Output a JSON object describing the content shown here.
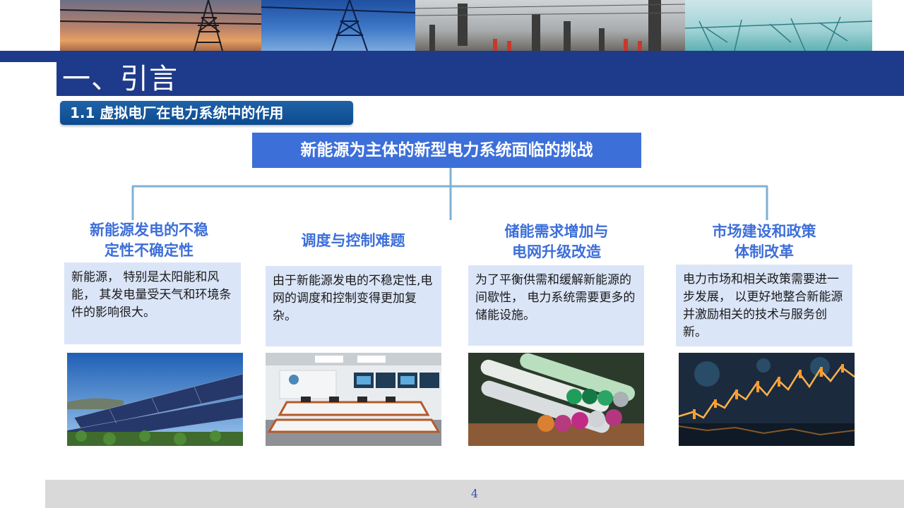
{
  "header": {
    "title": "一、引言",
    "subtitle": "1.1 虚拟电厂在电力系统中的作用"
  },
  "center_box": {
    "label": "新能源为主体的新型电力系统面临的挑战"
  },
  "columns": [
    {
      "heading": [
        "新能源发电的不稳",
        "定性不确定性"
      ],
      "body": "新能源， 特别是太阳能和风能， 其发电量受天气和环境条件的影响很大。",
      "image": "solar-panels-image"
    },
    {
      "heading": [
        "调度与控制难题"
      ],
      "body": "由于新能源发电的不稳定性,电网的调度和控制变得更加复杂。",
      "image": "control-room-image"
    },
    {
      "heading": [
        "储能需求增加与",
        "电网升级改造"
      ],
      "body": "为了平衡供需和缓解新能源的间歇性， 电力系统需要更多的储能设施。",
      "image": "batteries-image"
    },
    {
      "heading": [
        "市场建设和政策",
        "体制改革"
      ],
      "body": "电力市场和相关政策需要进一步发展， 以更好地整合新能源并激励相关的技术与服务创新。",
      "image": "market-chart-image"
    }
  ],
  "footer": {
    "page_number": "4"
  },
  "colors": {
    "navy": "#1e3a8a",
    "accent_blue": "#3d6fd9",
    "connector": "#7fb1d4",
    "desc_bg": "#dbe5f8",
    "footer_bg": "#d9d9d9"
  }
}
